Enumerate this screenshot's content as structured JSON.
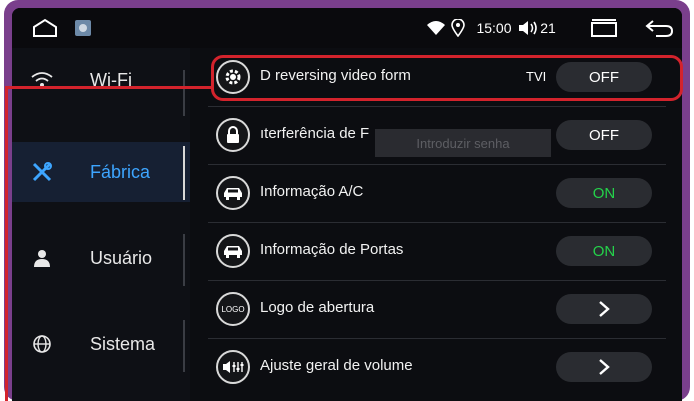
{
  "status_bar": {
    "icons": [
      "home-icon",
      "gallery-icon",
      "wifi-icon",
      "location-icon",
      "volume-icon",
      "recent-apps-icon",
      "back-icon"
    ],
    "time": "15:00",
    "volume": "21"
  },
  "sidebar": {
    "items": [
      {
        "label": "Wi-Fi",
        "icon": "wifi-icon",
        "active": false
      },
      {
        "label": "Fábrica",
        "icon": "tools-icon",
        "active": true
      },
      {
        "label": "Usuário",
        "icon": "user-icon",
        "active": false
      },
      {
        "label": "Sistema",
        "icon": "globe-icon",
        "active": false
      }
    ]
  },
  "settings": {
    "rows": [
      {
        "label": "D reversing video form",
        "icon": "gear-icon",
        "extra": "TVI",
        "control": "OFF",
        "control_type": "toggle"
      },
      {
        "label": "ıterferência de F",
        "icon": "lock-icon",
        "control": "OFF",
        "control_type": "toggle"
      },
      {
        "label": "Informação A/C",
        "icon": "car-icon",
        "control": "ON",
        "control_type": "toggle"
      },
      {
        "label": "Informação de Portas",
        "icon": "car-icon",
        "control": "ON",
        "control_type": "toggle"
      },
      {
        "label": "Logo de abertura",
        "icon": "logo-icon",
        "control": ">",
        "control_type": "arrow"
      },
      {
        "label": "Ajuste geral de volume",
        "icon": "volume-eq-icon",
        "control": ">",
        "control_type": "arrow"
      }
    ],
    "password_placeholder": "Introduzir senha",
    "logo_icon_text": "LOGO"
  },
  "colors": {
    "accent_blue": "#3da5ff",
    "on_green": "#24d34a",
    "highlight_red": "#d3232c",
    "frame_purple": "#7a3f8c"
  }
}
